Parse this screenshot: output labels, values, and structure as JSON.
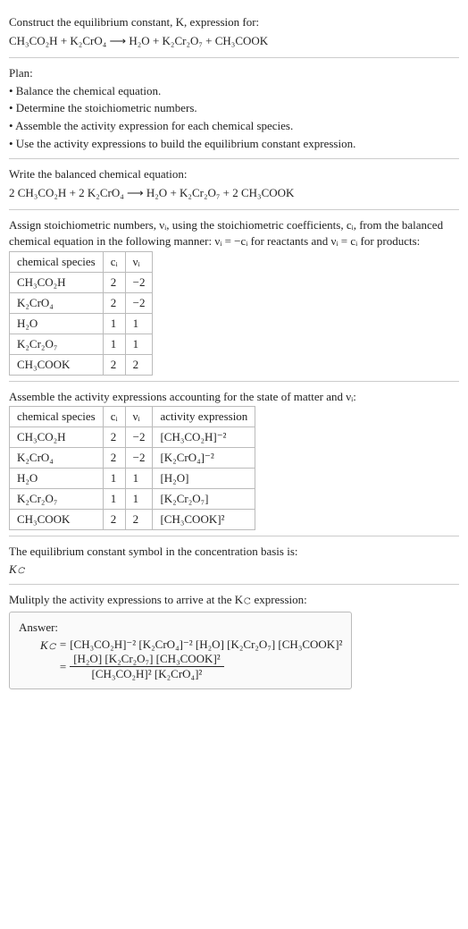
{
  "header": {
    "title_line": "Construct the equilibrium constant, K, expression for:",
    "equation": "CH₃CO₂H + K₂CrO₄  ⟶  H₂O + K₂Cr₂O₇ + CH₃COOK"
  },
  "plan": {
    "heading": "Plan:",
    "items": [
      "• Balance the chemical equation.",
      "• Determine the stoichiometric numbers.",
      "• Assemble the activity expression for each chemical species.",
      "• Use the activity expressions to build the equilibrium constant expression."
    ]
  },
  "balanced": {
    "heading": "Write the balanced chemical equation:",
    "equation": "2 CH₃CO₂H + 2 K₂CrO₄  ⟶  H₂O + K₂Cr₂O₇ + 2 CH₃COOK"
  },
  "stoich": {
    "intro1": "Assign stoichiometric numbers, νᵢ, using the stoichiometric coefficients, cᵢ, from the balanced chemical equation in the following manner: νᵢ = −cᵢ for reactants and νᵢ = cᵢ for products:",
    "h_species": "chemical species",
    "h_ci": "cᵢ",
    "h_vi": "νᵢ",
    "rows": [
      {
        "species": "CH₃CO₂H",
        "ci": "2",
        "vi": "−2"
      },
      {
        "species": "K₂CrO₄",
        "ci": "2",
        "vi": "−2"
      },
      {
        "species": "H₂O",
        "ci": "1",
        "vi": "1"
      },
      {
        "species": "K₂Cr₂O₇",
        "ci": "1",
        "vi": "1"
      },
      {
        "species": "CH₃COOK",
        "ci": "2",
        "vi": "2"
      }
    ]
  },
  "activity": {
    "intro": "Assemble the activity expressions accounting for the state of matter and νᵢ:",
    "h_species": "chemical species",
    "h_ci": "cᵢ",
    "h_vi": "νᵢ",
    "h_expr": "activity expression",
    "rows": [
      {
        "species": "CH₃CO₂H",
        "ci": "2",
        "vi": "−2",
        "expr": "[CH₃CO₂H]⁻²"
      },
      {
        "species": "K₂CrO₄",
        "ci": "2",
        "vi": "−2",
        "expr": "[K₂CrO₄]⁻²"
      },
      {
        "species": "H₂O",
        "ci": "1",
        "vi": "1",
        "expr": "[H₂O]"
      },
      {
        "species": "K₂Cr₂O₇",
        "ci": "1",
        "vi": "1",
        "expr": "[K₂Cr₂O₇]"
      },
      {
        "species": "CH₃COOK",
        "ci": "2",
        "vi": "2",
        "expr": "[CH₃COOK]²"
      }
    ]
  },
  "symbol": {
    "line1": "The equilibrium constant symbol in the concentration basis is:",
    "line2": "K𝚌"
  },
  "multiply": {
    "intro": "Mulitply the activity expressions to arrive at the K𝚌 expression:"
  },
  "answer": {
    "label": "Answer:",
    "lhs": "K𝚌",
    "row1_rhs": "[CH₃CO₂H]⁻² [K₂CrO₄]⁻² [H₂O] [K₂Cr₂O₇] [CH₃COOK]²",
    "frac_num": "[H₂O] [K₂Cr₂O₇] [CH₃COOK]²",
    "frac_den": "[CH₃CO₂H]² [K₂CrO₄]²"
  }
}
